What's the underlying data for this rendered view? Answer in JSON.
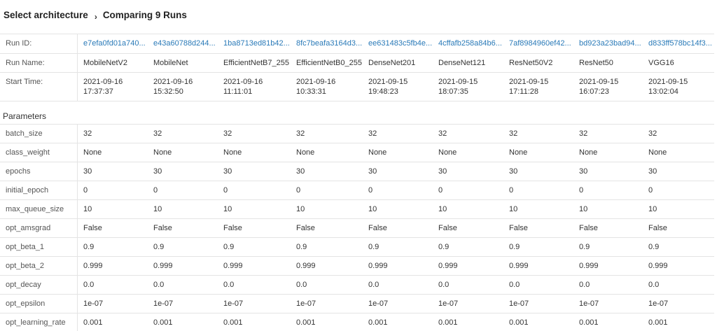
{
  "breadcrumb": {
    "parent": "Select architecture",
    "current": "Comparing 9 Runs"
  },
  "summary": {
    "labels": {
      "run_id": "Run ID:",
      "run_name": "Run Name:",
      "start_time": "Start Time:"
    },
    "runs": [
      {
        "id": "e7efa0fd01a740...",
        "name": "MobileNetV2",
        "date": "2021-09-16",
        "time": "17:37:37"
      },
      {
        "id": "e43a60788d244...",
        "name": "MobileNet",
        "date": "2021-09-16",
        "time": "15:32:50"
      },
      {
        "id": "1ba8713ed81b42...",
        "name": "EfficientNetB7_255",
        "date": "2021-09-16",
        "time": "11:11:01"
      },
      {
        "id": "8fc7beafa3164d3...",
        "name": "EfficientNetB0_255",
        "date": "2021-09-16",
        "time": "10:33:31"
      },
      {
        "id": "ee631483c5fb4e...",
        "name": "DenseNet201",
        "date": "2021-09-15",
        "time": "19:48:23"
      },
      {
        "id": "4cffafb258a84b6...",
        "name": "DenseNet121",
        "date": "2021-09-15",
        "time": "18:07:35"
      },
      {
        "id": "7af8984960ef42...",
        "name": "ResNet50V2",
        "date": "2021-09-15",
        "time": "17:11:28"
      },
      {
        "id": "bd923a23bad94...",
        "name": "ResNet50",
        "date": "2021-09-15",
        "time": "16:07:23"
      },
      {
        "id": "d833ff578bc14f3...",
        "name": "VGG16",
        "date": "2021-09-15",
        "time": "13:02:04"
      }
    ]
  },
  "parameters": {
    "title": "Parameters",
    "rows": [
      {
        "name": "batch_size",
        "values": [
          "32",
          "32",
          "32",
          "32",
          "32",
          "32",
          "32",
          "32",
          "32"
        ]
      },
      {
        "name": "class_weight",
        "values": [
          "None",
          "None",
          "None",
          "None",
          "None",
          "None",
          "None",
          "None",
          "None"
        ]
      },
      {
        "name": "epochs",
        "values": [
          "30",
          "30",
          "30",
          "30",
          "30",
          "30",
          "30",
          "30",
          "30"
        ]
      },
      {
        "name": "initial_epoch",
        "values": [
          "0",
          "0",
          "0",
          "0",
          "0",
          "0",
          "0",
          "0",
          "0"
        ]
      },
      {
        "name": "max_queue_size",
        "values": [
          "10",
          "10",
          "10",
          "10",
          "10",
          "10",
          "10",
          "10",
          "10"
        ]
      },
      {
        "name": "opt_amsgrad",
        "values": [
          "False",
          "False",
          "False",
          "False",
          "False",
          "False",
          "False",
          "False",
          "False"
        ]
      },
      {
        "name": "opt_beta_1",
        "values": [
          "0.9",
          "0.9",
          "0.9",
          "0.9",
          "0.9",
          "0.9",
          "0.9",
          "0.9",
          "0.9"
        ]
      },
      {
        "name": "opt_beta_2",
        "values": [
          "0.999",
          "0.999",
          "0.999",
          "0.999",
          "0.999",
          "0.999",
          "0.999",
          "0.999",
          "0.999"
        ]
      },
      {
        "name": "opt_decay",
        "values": [
          "0.0",
          "0.0",
          "0.0",
          "0.0",
          "0.0",
          "0.0",
          "0.0",
          "0.0",
          "0.0"
        ]
      },
      {
        "name": "opt_epsilon",
        "values": [
          "1e-07",
          "1e-07",
          "1e-07",
          "1e-07",
          "1e-07",
          "1e-07",
          "1e-07",
          "1e-07",
          "1e-07"
        ]
      },
      {
        "name": "opt_learning_rate",
        "values": [
          "0.001",
          "0.001",
          "0.001",
          "0.001",
          "0.001",
          "0.001",
          "0.001",
          "0.001",
          "0.001"
        ]
      }
    ]
  }
}
